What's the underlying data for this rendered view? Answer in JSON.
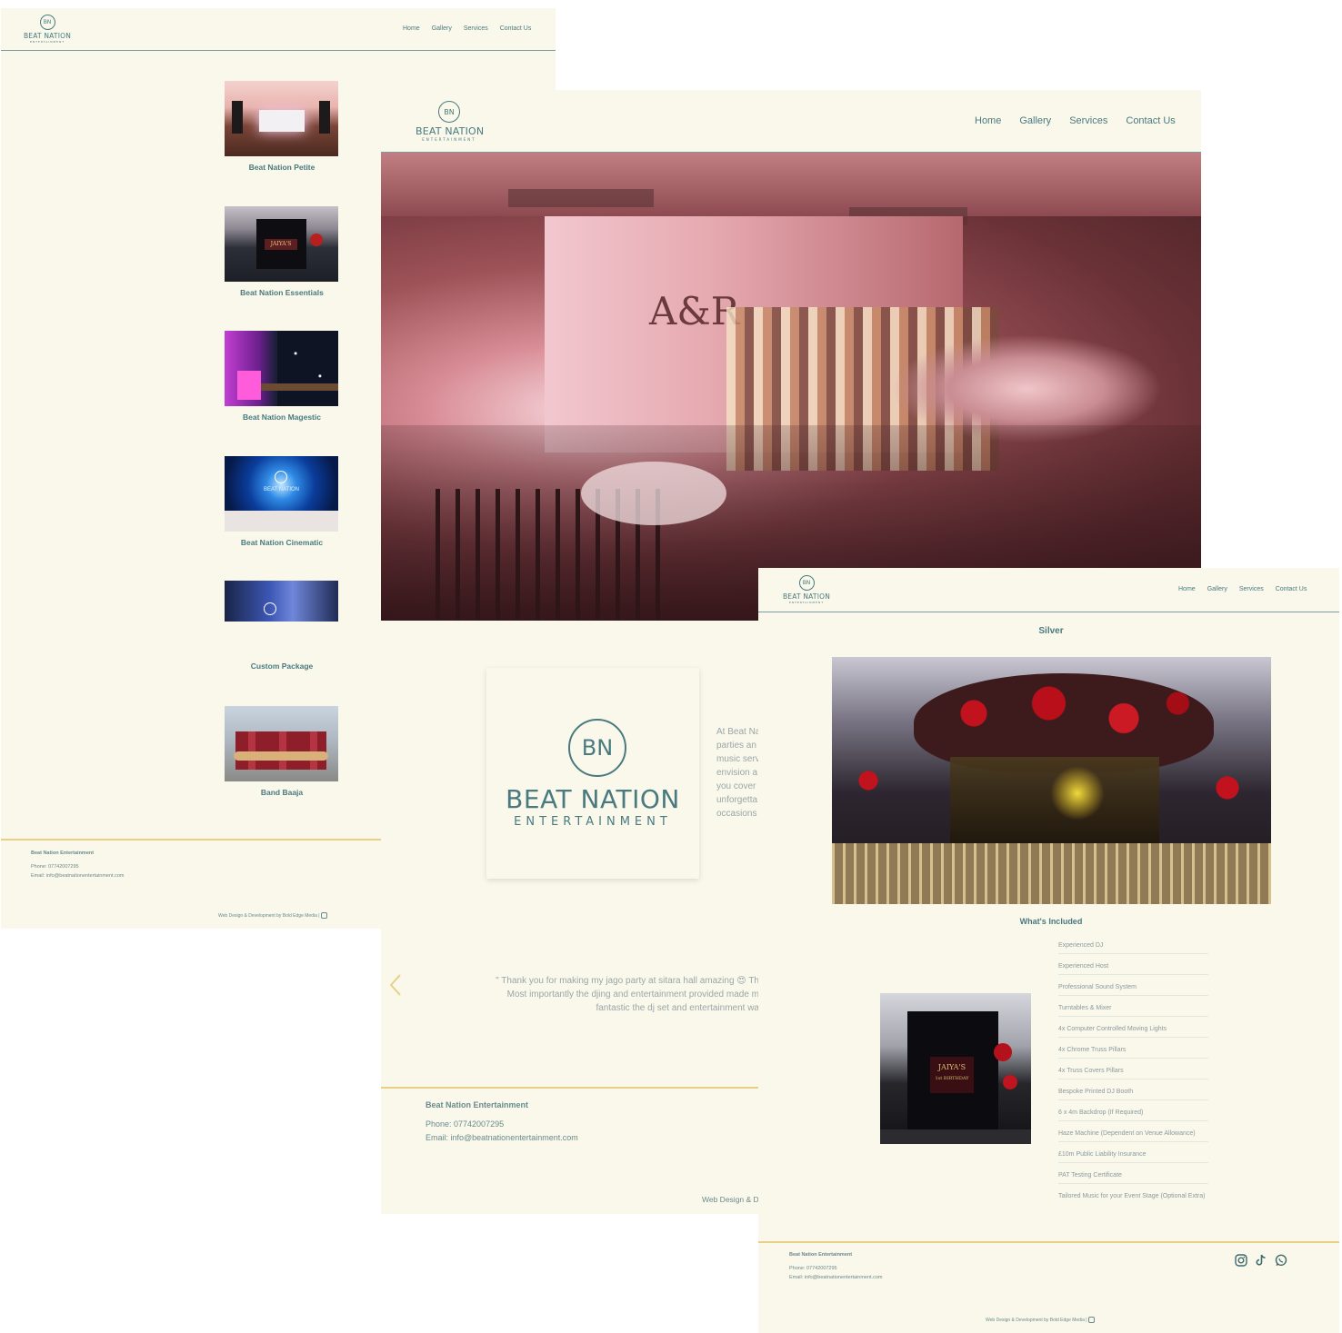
{
  "brand": {
    "initials": "BN",
    "name": "BEAT NATION",
    "sub": "ENTERTAINMENT"
  },
  "nav": {
    "home": "Home",
    "gallery": "Gallery",
    "services": "Services",
    "contact": "Contact Us"
  },
  "packages_page": {
    "packages": [
      {
        "label": "Beat Nation Petite"
      },
      {
        "label": "Beat Nation Essentials"
      },
      {
        "label": "Beat Nation Magestic"
      },
      {
        "label": "Beat Nation Cinematic"
      },
      {
        "label": "Custom Package"
      },
      {
        "label": "Band Baaja"
      }
    ],
    "footer": {
      "company": "Beat Nation Entertainment",
      "phone": "Phone: 07742007295",
      "email": "Email: info@beatnationentertainment.com",
      "credit": "Web Design & Development by Bold Edge Media |"
    }
  },
  "home_page": {
    "hero_text": "A&R",
    "about_lines": [
      "At Beat Na",
      "parties an",
      "music serv",
      "envision a",
      "you cover",
      "unforgetta",
      "occasions"
    ],
    "testimonial": {
      "line1": "\" Thank you for making my jago party at sitara hall amazing 😍 Th",
      "line2": "Most importantly the djing and entertainment provided made m",
      "line3": "fantastic the dj set and entertainment wa"
    },
    "footer": {
      "company": "Beat Nation Entertainment",
      "phone": "Phone: 07742007295",
      "email": "Email: info@beatnationentertainment.com",
      "credit": "Web Design & D"
    }
  },
  "silver_page": {
    "title": "Silver",
    "included_heading": "What's Included",
    "included": [
      "Experienced DJ",
      "Experienced Host",
      "Professional Sound System",
      "Turntables & Mixer",
      "4x Computer Controlled Moving Lights",
      "4x Chrome Truss Pillars",
      "4x Truss Covers Pillars",
      "Bespoke Printed DJ Booth",
      "6 x 4m Backdrop (If Required)",
      "Haze Machine (Dependent on Venue Allowance)",
      "£10m Public Liability Insurance",
      "PAT Testing Certificate",
      "Tailored Music for your Event Stage (Optional Extra)"
    ],
    "photo_text": "JAIYA'S",
    "photo_sub": "1st BIRTHDAY",
    "footer": {
      "company": "Beat Nation Entertainment",
      "phone": "Phone: 07742007295",
      "email": "Email: info@beatnationentertainment.com",
      "credit": "Web Design & Development by Bold Edge Media |"
    },
    "social_icons": [
      "instagram-icon",
      "tiktok-icon",
      "whatsapp-icon"
    ]
  },
  "colors": {
    "background": "#f9f8ea",
    "teal": "#4a7a80",
    "gold": "#e8cf84"
  }
}
